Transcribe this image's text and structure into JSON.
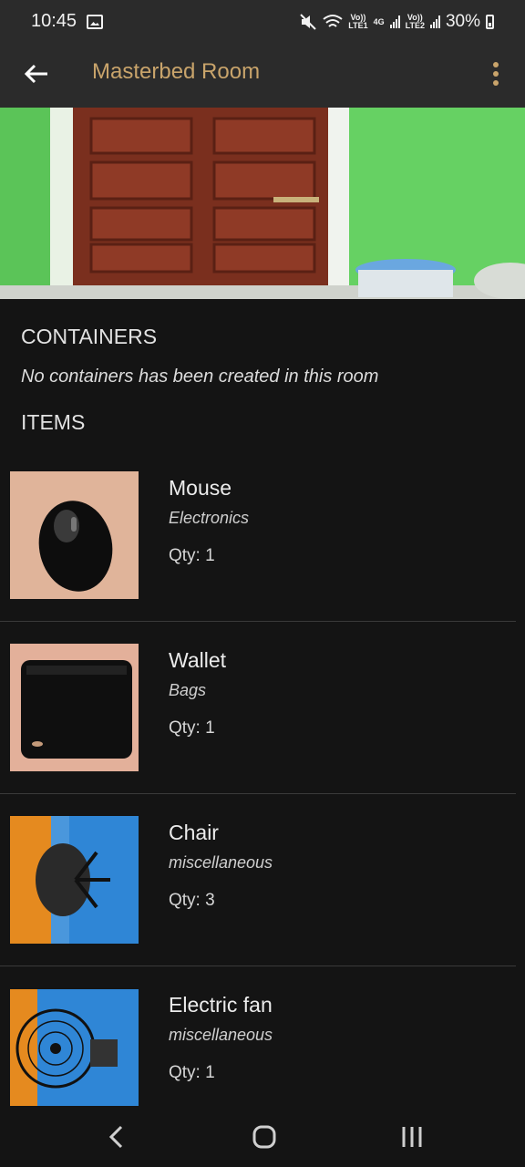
{
  "status_bar": {
    "time": "10:45",
    "lte1": "LTE1",
    "lte2": "LTE2",
    "volte": "Vo))",
    "net": "4G",
    "battery": "30%",
    "icons": [
      "image-icon",
      "mute-icon",
      "wifi-icon",
      "signal-icon",
      "battery-icon"
    ]
  },
  "app_bar": {
    "title": "Masterbed Room",
    "title_color": "#c9a46b",
    "back_icon": "arrow-left-icon",
    "menu_icon": "more-vertical-icon"
  },
  "containers": {
    "heading": "CONTAINERS",
    "empty_message": "No containers has been created in this room"
  },
  "items": {
    "heading": "ITEMS",
    "list": [
      {
        "name": "Mouse",
        "category": "Electronics",
        "qty": "Qty: 1"
      },
      {
        "name": "Wallet",
        "category": "Bags",
        "qty": "Qty: 1"
      },
      {
        "name": "Chair",
        "category": "miscellaneous",
        "qty": "Qty: 3"
      },
      {
        "name": "Electric fan",
        "category": "miscellaneous",
        "qty": "Qty: 1"
      }
    ]
  },
  "nav_bar": {
    "icons": [
      "back-nav-icon",
      "home-nav-icon",
      "recents-nav-icon"
    ]
  }
}
